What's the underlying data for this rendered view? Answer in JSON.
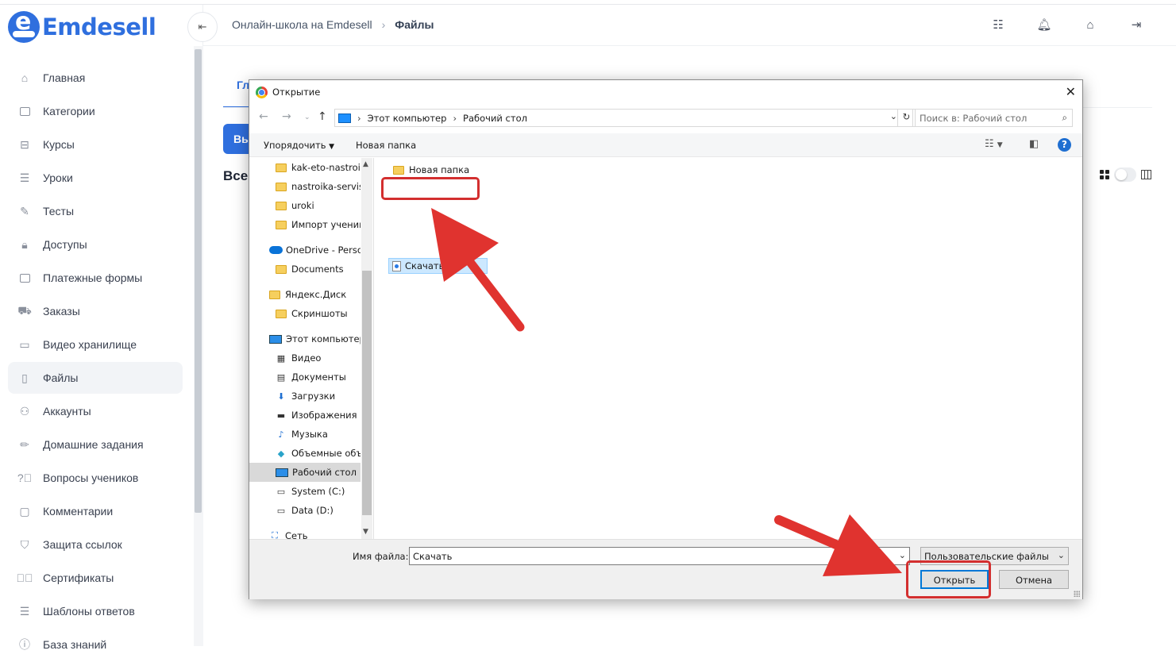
{
  "brand": {
    "name": "Emdesell"
  },
  "sidebar": {
    "items": [
      {
        "label": "Главная",
        "icon": "home-icon"
      },
      {
        "label": "Категории",
        "icon": "folder-icon"
      },
      {
        "label": "Курсы",
        "icon": "book-icon"
      },
      {
        "label": "Уроки",
        "icon": "list-icon"
      },
      {
        "label": "Тесты",
        "icon": "edit-icon"
      },
      {
        "label": "Доступы",
        "icon": "lock-icon"
      },
      {
        "label": "Платежные формы",
        "icon": "card-icon"
      },
      {
        "label": "Заказы",
        "icon": "cart-icon"
      },
      {
        "label": "Видео хранилище",
        "icon": "video-icon"
      },
      {
        "label": "Файлы",
        "icon": "file-icon",
        "active": true
      },
      {
        "label": "Аккаунты",
        "icon": "users-icon"
      },
      {
        "label": "Домашние задания",
        "icon": "pencil-icon"
      },
      {
        "label": "Вопросы учеников",
        "icon": "question-icon"
      },
      {
        "label": "Комментарии",
        "icon": "comment-icon"
      },
      {
        "label": "Защита ссылок",
        "icon": "shield-icon"
      },
      {
        "label": "Сертификаты",
        "icon": "check-circle-icon"
      },
      {
        "label": "Шаблоны ответов",
        "icon": "list-icon"
      },
      {
        "label": "База знаний",
        "icon": "info-icon"
      }
    ]
  },
  "header": {
    "crumb_root": "Онлайн-школа на Emdesell",
    "crumb_current": "Файлы",
    "icons": [
      "sliders-icon",
      "bell-icon",
      "home-settings-icon",
      "logout-icon"
    ]
  },
  "page": {
    "tab_label": "Гл",
    "button_label": "Вы",
    "heading": "Все"
  },
  "dialog": {
    "title": "Открытие",
    "address": {
      "root": "Этот компьютер",
      "current": "Рабочий стол"
    },
    "search_placeholder": "Поиск в: Рабочий стол",
    "toolbar": {
      "organize": "Упорядочить",
      "new_folder": "Новая папка"
    },
    "tree": [
      {
        "label": "kak-eto-nastroit",
        "type": "folder"
      },
      {
        "label": "nastroika-servisa",
        "type": "folder"
      },
      {
        "label": "uroki",
        "type": "folder"
      },
      {
        "label": "Импорт ученик",
        "type": "folder"
      },
      {
        "label": "OneDrive - Persor",
        "type": "cloud"
      },
      {
        "label": "Documents",
        "type": "folder"
      },
      {
        "label": "Яндекс.Диск",
        "type": "folder"
      },
      {
        "label": "Скриншоты",
        "type": "folder"
      },
      {
        "label": "Этот компьютер",
        "type": "pc"
      },
      {
        "label": "Видео",
        "type": "video"
      },
      {
        "label": "Документы",
        "type": "doc"
      },
      {
        "label": "Загрузки",
        "type": "download"
      },
      {
        "label": "Изображения",
        "type": "image"
      },
      {
        "label": "Музыка",
        "type": "music"
      },
      {
        "label": "Объемные объ",
        "type": "3d"
      },
      {
        "label": "Рабочий стол",
        "type": "desktop",
        "selected": true
      },
      {
        "label": "System (C:)",
        "type": "drive"
      },
      {
        "label": "Data (D:)",
        "type": "drive"
      },
      {
        "label": "Сеть",
        "type": "network"
      }
    ],
    "files": [
      {
        "name": "Новая папка",
        "type": "folder"
      },
      {
        "name": "Скачать",
        "type": "html",
        "selected": true
      }
    ],
    "filename_label": "Имя файла:",
    "filename_value": "Скачать",
    "filetype": "Пользовательские файлы",
    "open_label": "Открыть",
    "cancel_label": "Отмена"
  },
  "annotations": {
    "color": "#e0332f"
  }
}
